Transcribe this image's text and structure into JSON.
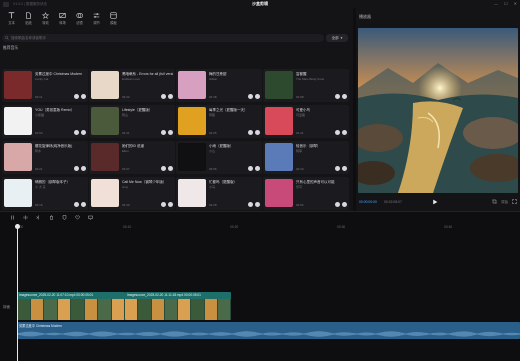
{
  "titlebar": {
    "meta": "V1.0.0 | 数据服务状态",
    "title": "沙盒剪辑"
  },
  "toolbar": [
    {
      "icon": "text-icon",
      "label": "文本"
    },
    {
      "icon": "sticker-icon",
      "label": "贴纸"
    },
    {
      "icon": "effects-icon",
      "label": "特效"
    },
    {
      "icon": "transition-icon",
      "label": "转场"
    },
    {
      "icon": "filter-icon",
      "label": "滤镜"
    },
    {
      "icon": "adjust-icon",
      "label": "调节"
    },
    {
      "icon": "template-icon",
      "label": "模板"
    }
  ],
  "search": {
    "placeholder": "搜索歌曲名称或者歌手",
    "button_label": "全部"
  },
  "section_title": "推荐音乐",
  "songs": [
    {
      "title": "劳累过度中 Christmas Modern",
      "artist": "Lucky Cat",
      "duration": "02:11",
      "color": "#7a2a2a"
    },
    {
      "title": "黑暗萌系 - Errors for all (full version)",
      "artist": "Endless Love",
      "duration": "03:32",
      "color": "#e8d8c8"
    },
    {
      "title": "梅的甘蔗甜",
      "artist": "Gillian",
      "duration": "02:48",
      "color": "#d8a0c0"
    },
    {
      "title": "富都醒",
      "artist": "The Mars Body Crew",
      "duration": "02:08",
      "color": "#2e4a2e"
    },
    {
      "title": "YOU（男孩童版 Remix）",
      "artist": "小熊猫",
      "duration": "01:54",
      "color": "#f2f2f2"
    },
    {
      "title": "Lifestyle（夏醒版）",
      "artist": "阿山",
      "duration": "02:41",
      "color": "#4a5a3a"
    },
    {
      "title": "每季之光（夏醒版一天）",
      "artist": "阿陌",
      "duration": "02:25",
      "color": "#e0a020"
    },
    {
      "title": "可爱小鸟",
      "artist": "可爱路",
      "duration": "01:41",
      "color": "#d84a5a"
    },
    {
      "title": "樱花旋律林(纯净音乐版)",
      "artist": "阿木",
      "duration": "02:21",
      "color": "#d8a8a8"
    },
    {
      "title": "她们的ID 说道",
      "artist": "Ellen",
      "duration": "02:07",
      "color": "#5a2a2a"
    },
    {
      "title": "小雨（夏醒版）",
      "artist": "小山",
      "duration": "03:06",
      "color": "#101012"
    },
    {
      "title": "轻音乐（钢琴）",
      "artist": "阿菲",
      "duration": "02:33",
      "color": "#5a7ab8"
    },
    {
      "title": "晴朗的（钢琴版本子）",
      "artist": "小 大 东",
      "duration": "02:16",
      "color": "#e8f0f4"
    },
    {
      "title": "Call Me Now（钢琴少年版）",
      "artist": "Amy",
      "duration": "02:30",
      "color": "#f0e0d8"
    },
    {
      "title": "忙都吗（夏醒版）",
      "artist": "小马",
      "duration": "02:28",
      "color": "#f0e8e8"
    },
    {
      "title": "只有心里的声音可以可能",
      "artist": "乐可",
      "duration": "02:52",
      "color": "#c84a78"
    }
  ],
  "preview": {
    "title": "播放器",
    "current_time": "00:00:00:00",
    "total_time": "00:02:08:07",
    "ratio_label": "原始"
  },
  "timeline": {
    "ticks": [
      "00:00",
      "00:10",
      "00:20",
      "00:30",
      "00:40"
    ],
    "track_label": "封面",
    "clips": [
      {
        "label": "imagesource_2025-02-20 11:07:10.mp4 00:00:05:01",
        "color": "#1e6f6a"
      },
      {
        "label": "imagesource_2025-02-20 11:11:18.mp4 00:00:05:01",
        "color": "#1e6f6a"
      }
    ],
    "audio_label": "劳累过度中 Christmas Modern",
    "audio_color": "#2a5f8a"
  }
}
